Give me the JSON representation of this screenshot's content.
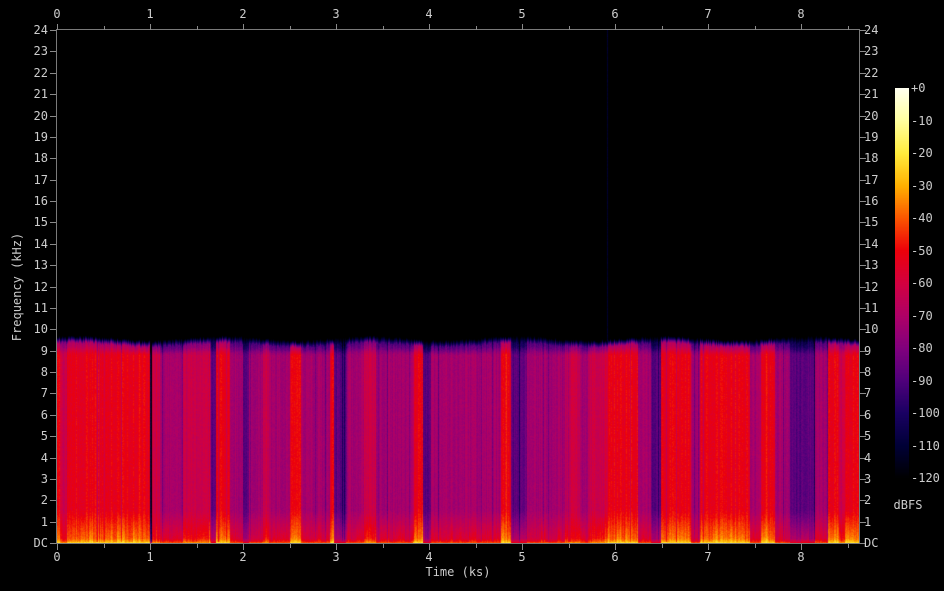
{
  "colors": {
    "background": "#000000",
    "axis_line": "#7a7a7a",
    "tick_mark": "#8a8a8a",
    "tick_label": "#cdcdcd"
  },
  "labels": {
    "x_axis": "Time (ks)",
    "y_axis": "Frequency (kHz)",
    "colorbar": "dBFS"
  },
  "axes": {
    "x_tick_labels": [
      "0",
      "1",
      "2",
      "3",
      "4",
      "5",
      "6",
      "7",
      "8"
    ],
    "y_tick_labels": [
      "24",
      "23",
      "22",
      "21",
      "20",
      "19",
      "18",
      "17",
      "16",
      "15",
      "14",
      "13",
      "12",
      "11",
      "10",
      "9",
      "8",
      "7",
      "6",
      "5",
      "4",
      "3",
      "2",
      "1",
      "DC"
    ],
    "colorbar_tick_labels": [
      "+0",
      "-10",
      "-20",
      "-30",
      "-40",
      "-50",
      "-60",
      "-70",
      "-80",
      "-90",
      "-100",
      "-110",
      "-120"
    ]
  },
  "chart_data": {
    "type": "heatmap",
    "subtype": "audio-spectrogram",
    "title": "",
    "xlabel": "Time (ks)",
    "ylabel": "Frequency (kHz)",
    "colorbar_label": "dBFS",
    "x_range_ks": [
      0,
      8.63
    ],
    "x_major_tick_step_ks": 1,
    "x_minor_tick_step_ks": 0.5,
    "y_range_khz": [
      0,
      24
    ],
    "y_tick_step_khz": 1,
    "colorbar_range_db": [
      0,
      -120
    ],
    "colorbar_tick_step_db": 10,
    "signal_band_top_khz": 9.4,
    "notes": "Broadband program material occupies DC to ~9.4 kHz for the whole duration; 9.4-24 kHz is silent (black). Loudness alternates in vertical segments; energy is strongest below ~1.5 kHz (orange/yellow near DC). A single faint dark-blue vertical line extends above the band at t = 5.91 ks.",
    "palette_stops": [
      {
        "db": 0,
        "rgb": [
          255,
          255,
          240
        ]
      },
      {
        "db": -10,
        "rgb": [
          255,
          255,
          159
        ]
      },
      {
        "db": -20,
        "rgb": [
          255,
          236,
          61
        ]
      },
      {
        "db": -30,
        "rgb": [
          255,
          176,
          0
        ]
      },
      {
        "db": -40,
        "rgb": [
          251,
          85,
          0
        ]
      },
      {
        "db": -50,
        "rgb": [
          236,
          0,
          11
        ]
      },
      {
        "db": -60,
        "rgb": [
          210,
          0,
          64
        ]
      },
      {
        "db": -70,
        "rgb": [
          174,
          0,
          103
        ]
      },
      {
        "db": -80,
        "rgb": [
          129,
          0,
          125
        ]
      },
      {
        "db": -90,
        "rgb": [
          79,
          0,
          123
        ]
      },
      {
        "db": -100,
        "rgb": [
          25,
          0,
          98
        ]
      },
      {
        "db": -110,
        "rgb": [
          0,
          0,
          54
        ]
      },
      {
        "db": -120,
        "rgb": [
          0,
          0,
          0
        ]
      }
    ],
    "level_classes": {
      "loud": {
        "dc_db": -26,
        "low_db": -38,
        "mid_db": -52
      },
      "med": {
        "dc_db": -36,
        "low_db": -50,
        "mid_db": -62
      },
      "soft": {
        "dc_db": -44,
        "low_db": -58,
        "mid_db": -72
      },
      "quiet": {
        "dc_db": -55,
        "low_db": -72,
        "mid_db": -88
      },
      "gap": {
        "dc_db": -70,
        "low_db": -90,
        "mid_db": -108
      }
    },
    "segments": [
      {
        "t0": 0.0,
        "t1": 0.03,
        "level": "loud"
      },
      {
        "t0": 0.03,
        "t1": 0.1,
        "level": "med"
      },
      {
        "t0": 0.1,
        "t1": 1.0,
        "level": "loud"
      },
      {
        "t0": 1.0,
        "t1": 1.02,
        "level": "gap"
      },
      {
        "t0": 1.02,
        "t1": 1.1,
        "level": "med"
      },
      {
        "t0": 1.1,
        "t1": 1.35,
        "level": "soft"
      },
      {
        "t0": 1.35,
        "t1": 1.65,
        "level": "med"
      },
      {
        "t0": 1.65,
        "t1": 1.7,
        "level": "quiet"
      },
      {
        "t0": 1.7,
        "t1": 1.86,
        "level": "loud"
      },
      {
        "t0": 1.86,
        "t1": 2.0,
        "level": "soft"
      },
      {
        "t0": 2.0,
        "t1": 2.06,
        "level": "quiet"
      },
      {
        "t0": 2.06,
        "t1": 2.2,
        "level": "soft"
      },
      {
        "t0": 2.2,
        "t1": 2.27,
        "level": "med"
      },
      {
        "t0": 2.27,
        "t1": 2.5,
        "level": "soft"
      },
      {
        "t0": 2.5,
        "t1": 2.62,
        "level": "loud"
      },
      {
        "t0": 2.62,
        "t1": 2.93,
        "level": "soft"
      },
      {
        "t0": 2.93,
        "t1": 2.97,
        "level": "loud"
      },
      {
        "t0": 2.97,
        "t1": 3.1,
        "level": "quiet"
      },
      {
        "t0": 3.1,
        "t1": 3.3,
        "level": "soft"
      },
      {
        "t0": 3.3,
        "t1": 3.42,
        "level": "med"
      },
      {
        "t0": 3.42,
        "t1": 3.82,
        "level": "soft"
      },
      {
        "t0": 3.82,
        "t1": 3.93,
        "level": "loud"
      },
      {
        "t0": 3.93,
        "t1": 4.02,
        "level": "quiet"
      },
      {
        "t0": 4.02,
        "t1": 4.77,
        "level": "soft"
      },
      {
        "t0": 4.77,
        "t1": 4.88,
        "level": "loud"
      },
      {
        "t0": 4.88,
        "t1": 5.05,
        "level": "quiet"
      },
      {
        "t0": 5.05,
        "t1": 5.48,
        "level": "soft"
      },
      {
        "t0": 5.48,
        "t1": 5.62,
        "level": "med"
      },
      {
        "t0": 5.62,
        "t1": 5.73,
        "level": "soft"
      },
      {
        "t0": 5.73,
        "t1": 5.91,
        "level": "med"
      },
      {
        "t0": 5.91,
        "t1": 6.24,
        "level": "loud"
      },
      {
        "t0": 6.24,
        "t1": 6.38,
        "level": "soft"
      },
      {
        "t0": 6.38,
        "t1": 6.49,
        "level": "quiet"
      },
      {
        "t0": 6.49,
        "t1": 6.81,
        "level": "loud"
      },
      {
        "t0": 6.81,
        "t1": 6.91,
        "level": "soft"
      },
      {
        "t0": 6.91,
        "t1": 7.45,
        "level": "loud"
      },
      {
        "t0": 7.45,
        "t1": 7.56,
        "level": "soft"
      },
      {
        "t0": 7.56,
        "t1": 7.72,
        "level": "loud"
      },
      {
        "t0": 7.72,
        "t1": 7.88,
        "level": "soft"
      },
      {
        "t0": 7.88,
        "t1": 8.15,
        "level": "quiet"
      },
      {
        "t0": 8.15,
        "t1": 8.28,
        "level": "soft"
      },
      {
        "t0": 8.28,
        "t1": 8.4,
        "level": "loud"
      },
      {
        "t0": 8.4,
        "t1": 8.47,
        "level": "med"
      },
      {
        "t0": 8.47,
        "t1": 8.63,
        "level": "loud"
      }
    ],
    "tall_faint_line": {
      "t_ks": 5.91,
      "db": -111
    }
  }
}
